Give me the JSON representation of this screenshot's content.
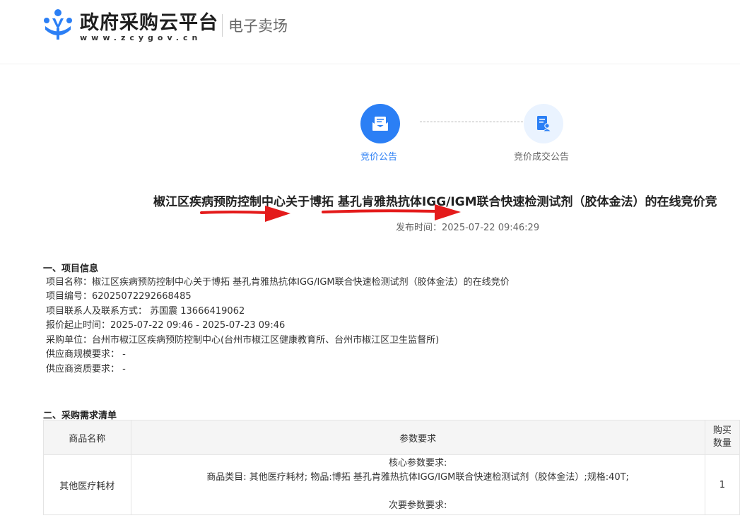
{
  "header": {
    "logo_title": "政府采购云平台",
    "logo_url": "www.zcygov.cn",
    "logo_sub": "电子卖场"
  },
  "steps": [
    {
      "label": "竞价公告",
      "state": "active",
      "icon": "envelope-icon"
    },
    {
      "label": "竞价成交公告",
      "state": "inactive",
      "icon": "document-user-icon"
    }
  ],
  "announcement": {
    "title": "椒江区疾病预防控制中心关于博拓 基孔肯雅热抗体IGG/IGM联合快速检测试剂（胶体金法）的在线竞价竞",
    "pubtime_label": "发布时间：",
    "pubtime_value": "2025-07-22 09:46:29"
  },
  "section1": {
    "heading": "一、项目信息",
    "lines": [
      "项目名称：椒江区疾病预防控制中心关于博拓 基孔肯雅热抗体IGG/IGM联合快速检测试剂（胶体金法）的在线竞价",
      "项目编号：62025072292668485",
      "项目联系人及联系方式： 苏国震  13666419062",
      "报价起止时间：2025-07-22 09:46  -  2025-07-23 09:46",
      "采购单位：台州市椒江区疾病预防控制中心(台州市椒江区健康教育所、台州市椒江区卫生监督所)",
      "供应商规模要求： -",
      "供应商资质要求： -"
    ]
  },
  "section2": {
    "heading": "二、采购需求清单",
    "columns": [
      "商品名称",
      "参数要求",
      "购买数量"
    ],
    "col3_lines": [
      "购买",
      "数量"
    ],
    "rows": [
      {
        "name": "其他医疗耗材",
        "params": [
          "核心参数要求:",
          "商品类目: 其他医疗耗材; 物品:博拓 基孔肯雅热抗体IGG/IGM联合快速检测试剂（胶体金法）;规格:40T;",
          "",
          "次要参数要求:"
        ],
        "qty": "1"
      }
    ]
  },
  "colors": {
    "accent": "#2b7ff5",
    "accent_light": "#eaf3ff",
    "arrow_red": "#e41b1b"
  }
}
